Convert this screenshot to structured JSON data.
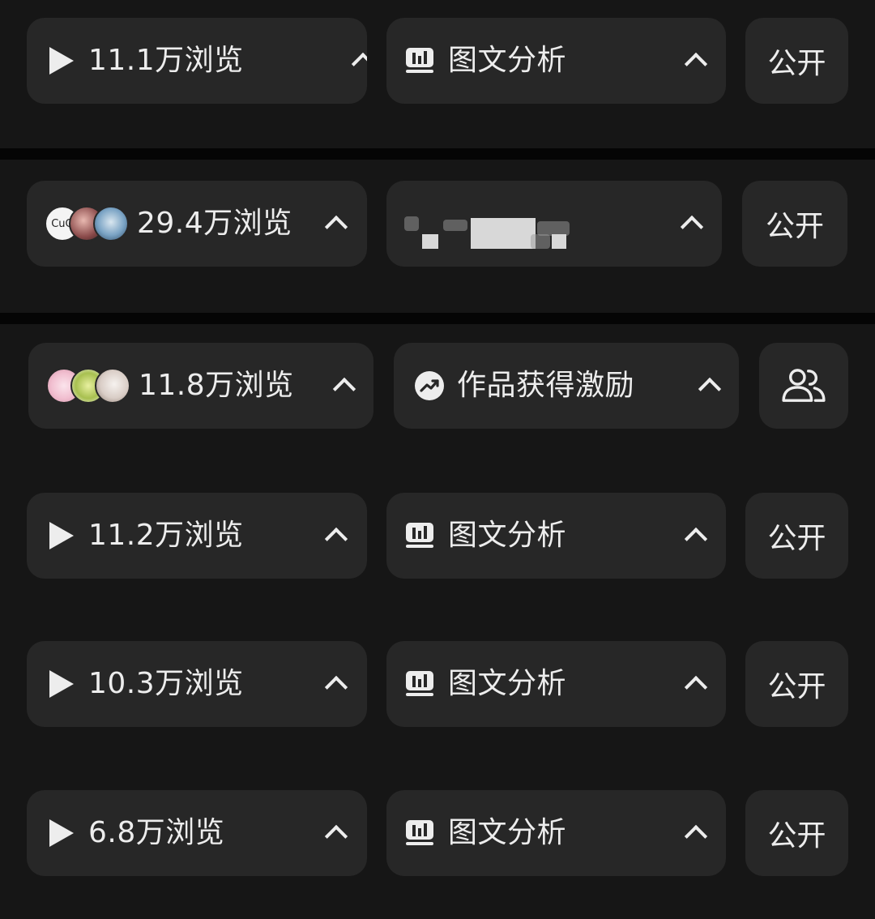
{
  "rows": [
    {
      "views_label": "11.1万浏览",
      "view_icon": "play-icon",
      "analysis_icon": "bar-chart-icon",
      "analysis_label": "图文分析",
      "visibility_label": "公开"
    },
    {
      "views_label": "29.4万浏览",
      "view_icon": "avatar-stack",
      "avatar_text": "CuO",
      "analysis_label": "",
      "visibility_label": "公开"
    },
    {
      "views_label": "11.8万浏览",
      "view_icon": "avatar-stack",
      "analysis_icon": "trending-up-icon",
      "analysis_label": "作品获得激励",
      "visibility_icon": "people-icon"
    },
    {
      "views_label": "11.2万浏览",
      "view_icon": "play-icon",
      "analysis_icon": "bar-chart-icon",
      "analysis_label": "图文分析",
      "visibility_label": "公开"
    },
    {
      "views_label": "10.3万浏览",
      "view_icon": "play-icon",
      "analysis_icon": "bar-chart-icon",
      "analysis_label": "图文分析",
      "visibility_label": "公开"
    },
    {
      "views_label": "6.8万浏览",
      "view_icon": "play-icon",
      "analysis_icon": "bar-chart-icon",
      "analysis_label": "图文分析",
      "visibility_label": "公开"
    }
  ],
  "colors": {
    "background": "#161616",
    "pill": "#272727",
    "divider": "#050505",
    "text": "#ededed"
  }
}
